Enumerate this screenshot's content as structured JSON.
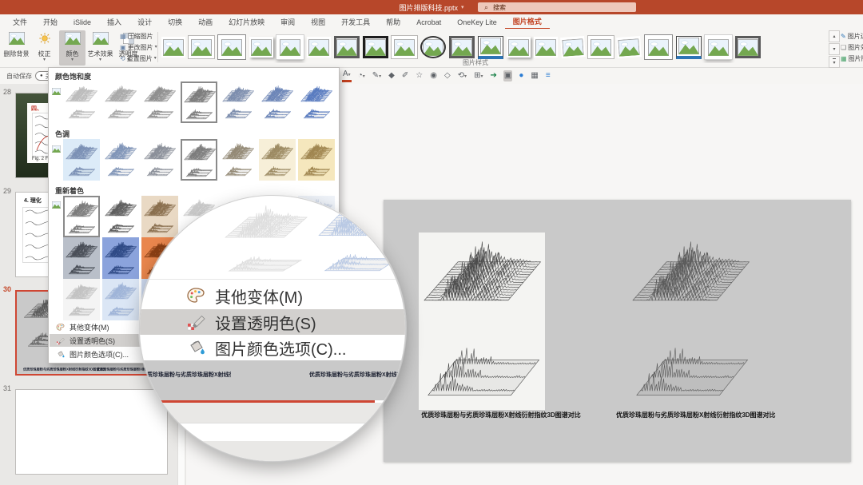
{
  "window": {
    "title": "图片排版科技.pptx",
    "search_placeholder": "搜索"
  },
  "icons": {
    "caret": "▾",
    "up": "▴",
    "down": "▾",
    "search": "⌕",
    "autosave_dot": "●",
    "minibar": [
      "A",
      "◔",
      "✎",
      "◆",
      "✐",
      "☆",
      "◉",
      "◇",
      "⟲",
      "⊞",
      "➔",
      "▣",
      "●",
      "▦",
      "≡"
    ]
  },
  "tabs": [
    {
      "label": "文件"
    },
    {
      "label": "开始"
    },
    {
      "label": "iSlide"
    },
    {
      "label": "插入"
    },
    {
      "label": "设计"
    },
    {
      "label": "切换"
    },
    {
      "label": "动画"
    },
    {
      "label": "幻灯片放映"
    },
    {
      "label": "审阅"
    },
    {
      "label": "视图"
    },
    {
      "label": "开发工具"
    },
    {
      "label": "帮助"
    },
    {
      "label": "Acrobat"
    },
    {
      "label": "OneKey Lite"
    },
    {
      "label": "图片格式",
      "active": true
    }
  ],
  "ribbon": {
    "adjust": [
      {
        "label": "删除背景"
      },
      {
        "label": "校正"
      },
      {
        "label": "颜色",
        "selected": true
      },
      {
        "label": "艺术效果"
      },
      {
        "label": "透明度"
      }
    ],
    "adjust_small": [
      {
        "label": "压缩图片"
      },
      {
        "label": "更改图片"
      },
      {
        "label": "重置图片"
      }
    ],
    "styles_group_label": "图片样式",
    "right": [
      {
        "label": "图片边框"
      },
      {
        "label": "图片效果"
      },
      {
        "label": "图片版式"
      }
    ],
    "gallery_count": 21
  },
  "quickbar": {
    "autosave_label": "自动保存",
    "autosave_state": "关"
  },
  "color_menu": {
    "sections": [
      {
        "title": "颜色饱和度",
        "selected_index": 3,
        "thumbs": [
          {
            "bg": "#ffffff",
            "stroke": "#bcbcbc"
          },
          {
            "bg": "#ffffff",
            "stroke": "#a9a9a9"
          },
          {
            "bg": "#ffffff",
            "stroke": "#8f8f8f"
          },
          {
            "bg": "#ffffff",
            "stroke": "#7c7c7c"
          },
          {
            "bg": "#ffffff",
            "stroke": "#7d8eae"
          },
          {
            "bg": "#ffffff",
            "stroke": "#6d86b8"
          },
          {
            "bg": "#ffffff",
            "stroke": "#5a7cc0"
          }
        ]
      },
      {
        "title": "色调",
        "selected_index": 3,
        "thumbs": [
          {
            "bg": "#dcebf8",
            "stroke": "#7b90b5"
          },
          {
            "bg": "#ffffff",
            "stroke": "#8095b8"
          },
          {
            "bg": "#ffffff",
            "stroke": "#8a8f99"
          },
          {
            "bg": "#ffffff",
            "stroke": "#7c7c7c"
          },
          {
            "bg": "#ffffff",
            "stroke": "#948a76"
          },
          {
            "bg": "#f7efd8",
            "stroke": "#9c8a62"
          },
          {
            "bg": "#f5e7bd",
            "stroke": "#a08650"
          }
        ]
      },
      {
        "title": "重新着色",
        "rows": [
          [
            {
              "bg": "#ffffff",
              "stroke": "#7c7c7c",
              "sel": true
            },
            {
              "bg": "#ffffff",
              "stroke": "#5e5e5e"
            },
            {
              "bg": "#e9d9c4",
              "stroke": "#8a6f4e"
            },
            {
              "bg": "#ffffff",
              "stroke": "#c9c9c9"
            },
            {
              "bg": "#ffffff",
              "stroke": "#d6d6d6"
            },
            {
              "bg": "#ffffff",
              "stroke": "#dadee6"
            },
            {
              "bg": "#eef2f8",
              "stroke": "#c5cfe2"
            }
          ],
          [
            {
              "bg": "#b9bfc9",
              "stroke": "#4a4f58"
            },
            {
              "bg": "#8ba3dc",
              "stroke": "#2f4a86"
            },
            {
              "bg": "#e9864d",
              "stroke": "#8a3f14"
            },
            {
              "bg": "#f2f2f2",
              "stroke": "#bdbdbd"
            },
            {
              "bg": "#ffffff",
              "stroke": "#d0d0d0"
            },
            {
              "bg": "#ffffff",
              "stroke": "#ccd4e4"
            },
            {
              "bg": "#dce4f2",
              "stroke": "#aebbd6"
            }
          ],
          [
            {
              "bg": "#f4f4f4",
              "stroke": "#c2c2c2"
            },
            {
              "bg": "#dbe6f5",
              "stroke": "#9fb4d8"
            },
            {
              "bg": "#cdd9ee",
              "stroke": "#8fa6cf"
            },
            {
              "bg": "#ffffff",
              "stroke": "#d8d8d8"
            },
            {
              "bg": "#ffffff",
              "stroke": "#dddddd"
            },
            {
              "bg": "#ffffff",
              "stroke": "#e0e0e0"
            },
            {
              "bg": "#ffffff",
              "stroke": "#e4e4e4"
            }
          ]
        ]
      }
    ],
    "menu_items": [
      {
        "label": "其他变体(M)",
        "icon": "palette-icon"
      },
      {
        "label": "设置透明色(S)",
        "icon": "set-transparent-color-icon",
        "highlighted": true
      },
      {
        "label": "图片颜色选项(C)...",
        "icon": "picture-color-options-icon"
      }
    ]
  },
  "slide_panel": {
    "slides": [
      {
        "number": "28"
      },
      {
        "number": "29",
        "title": "4. 理化"
      },
      {
        "number": "30",
        "selected": true
      },
      {
        "number": "31"
      }
    ]
  },
  "slide28": {
    "title": "四、",
    "caption": "Fig. 2 FTIR spectra"
  },
  "slide": {
    "caption_left": "优质珍珠层粉与劣质珍珠层粉X射线衍射指纹3D图谱对比",
    "caption_right": "优质珍珠层粉与劣质珍珠层粉X射线衍射指纹3D图谱对比"
  },
  "colors": {
    "titlebar": "#b7472a",
    "search_bg": "#eec8bb",
    "accent_red": "#c2401f",
    "selection_red": "#cf4633",
    "menu_highlight": "#d2d0ce",
    "slide_bg": "#c9c9c9",
    "plot_stroke": "#4a4a4a",
    "ghost_gray": "#dedede",
    "ghost_blue": "#b9c9e4"
  }
}
